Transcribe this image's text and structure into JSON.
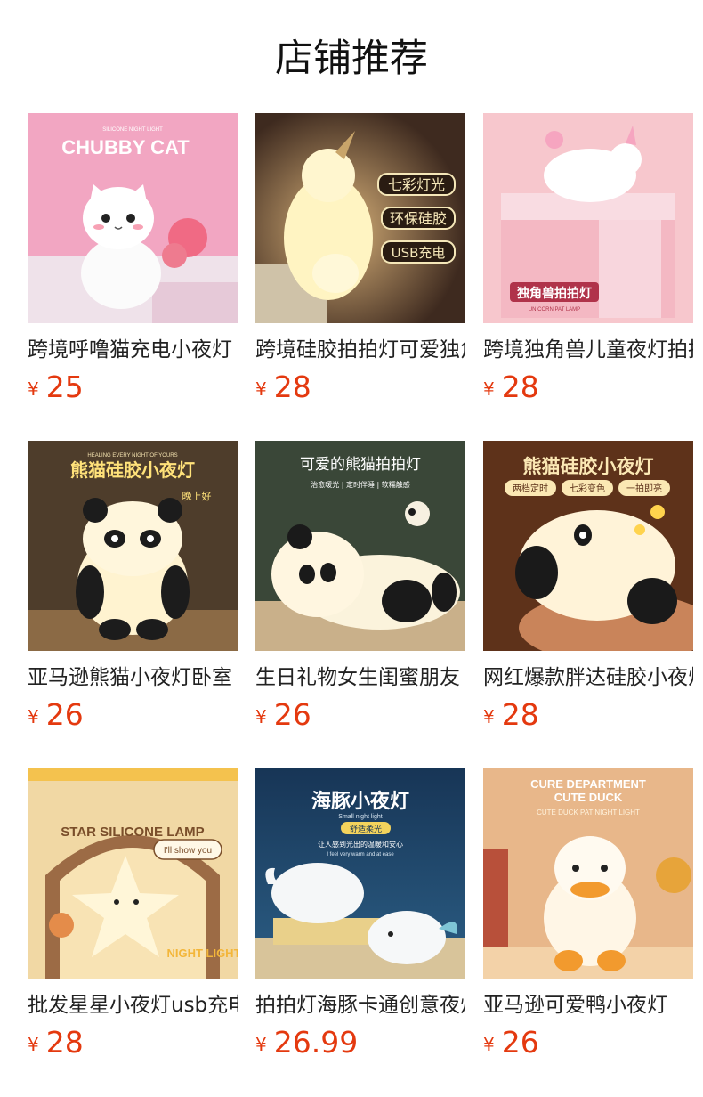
{
  "title": "店铺推荐",
  "currency_symbol": "¥",
  "products": [
    {
      "name": "跨境呼噜猫充电小夜灯",
      "price": "25",
      "image": {
        "theme": "cat",
        "bg": "#f3a9c4",
        "text": [
          "SILICONE NIGHT LIGHT",
          "CHUBBY CAT"
        ]
      }
    },
    {
      "name": "跨境硅胶拍拍灯可爱独角兽",
      "price": "28",
      "image": {
        "theme": "unicorn-lit",
        "bg": "#4a3226",
        "text": [
          "七彩灯光",
          "环保硅胶",
          "USB充电"
        ]
      }
    },
    {
      "name": "跨境独角兽儿童夜灯拍拍灯",
      "price": "28",
      "image": {
        "theme": "unicorn-box",
        "bg": "#f6c9cf",
        "text": [
          "独角兽拍拍灯",
          "UNICORN PAT LAMP"
        ]
      }
    },
    {
      "name": "亚马逊熊猫小夜灯卧室",
      "price": "26",
      "image": {
        "theme": "panda-sit",
        "bg": "#5b4a32",
        "text": [
          "HEALING EVERY NIGHT OF YOURS",
          "熊猫硅胶小夜灯",
          "晚上好"
        ]
      }
    },
    {
      "name": "生日礼物女生闺蜜朋友",
      "price": "26",
      "image": {
        "theme": "panda-lie",
        "bg": "#3d4a3a",
        "text": [
          "可爱的熊猫拍拍灯",
          "治愈暖光 | 定时伴睡 | 软糯触感"
        ]
      }
    },
    {
      "name": "网红爆款胖达硅胶小夜灯",
      "price": "28",
      "image": {
        "theme": "panda-hand",
        "bg": "#6b3a1f",
        "text": [
          "熊猫硅胶小夜灯",
          "两档定时",
          "七彩变色",
          "一拍即亮"
        ]
      }
    },
    {
      "name": "批发星星小夜灯usb充电",
      "price": "28",
      "image": {
        "theme": "star",
        "bg": "#f2d49a",
        "text": [
          "STAR SILICONE LAMP",
          "I'll show you",
          "NIGHT LIGHT"
        ]
      }
    },
    {
      "name": "拍拍灯海豚卡通创意夜灯",
      "price": "26.99",
      "image": {
        "theme": "dolphin",
        "bg": "#1f3a5a",
        "text": [
          "海豚小夜灯",
          "Small night light",
          "舒适柔光",
          "让人感到光出的温暖和安心",
          "I feel very warm and at ease"
        ]
      }
    },
    {
      "name": "亚马逊可爱鸭小夜灯",
      "price": "26",
      "image": {
        "theme": "duck",
        "bg": "#e9b98a",
        "text": [
          "CURE DEPARTMENT",
          "CUTE DUCK",
          "CUTE DUCK PAT NIGHT LIGHT"
        ]
      }
    }
  ]
}
